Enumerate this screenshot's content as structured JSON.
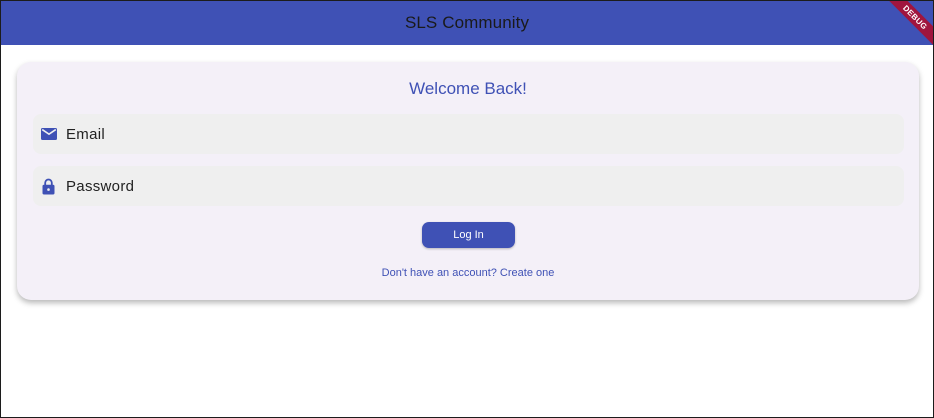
{
  "appbar": {
    "title": "SLS Community",
    "debug_banner": "DEBUG"
  },
  "login_card": {
    "title": "Welcome Back!",
    "email": {
      "placeholder": "Email",
      "value": "",
      "icon": "email-icon"
    },
    "password": {
      "placeholder": "Password",
      "value": "",
      "icon": "lock-icon"
    },
    "login_label": "Log In",
    "create_account_label": "Don't have an account? Create one"
  },
  "colors": {
    "primary": "#3f51b5",
    "card_background": "#f4f0f8",
    "field_background": "#efefef",
    "debug_ribbon": "#a0153e"
  }
}
